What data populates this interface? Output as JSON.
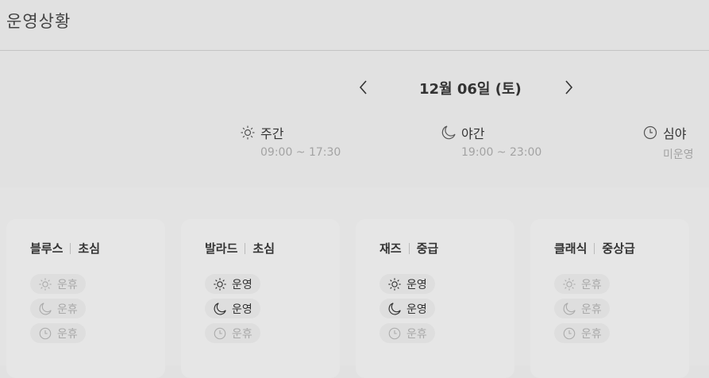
{
  "header": {
    "title": "운영상황"
  },
  "date_nav": {
    "date": "12월 06일 (토)",
    "prev_icon": "chevron-left-icon",
    "next_icon": "chevron-right-icon"
  },
  "shifts": [
    {
      "icon": "sun-icon",
      "name": "주간",
      "time": "09:00 ~ 17:30"
    },
    {
      "icon": "moon-icon",
      "name": "야간",
      "time": "19:00 ~ 23:00"
    },
    {
      "icon": "clock-icon",
      "name": "심야",
      "time": "미운영"
    }
  ],
  "cards": [
    {
      "genre": "블루스",
      "level": "초심",
      "rows": [
        {
          "label": "운휴",
          "active": false
        },
        {
          "label": "운휴",
          "active": false
        },
        {
          "label": "운휴",
          "active": false
        }
      ]
    },
    {
      "genre": "발라드",
      "level": "초심",
      "rows": [
        {
          "label": "운영",
          "active": true
        },
        {
          "label": "운영",
          "active": true
        },
        {
          "label": "운휴",
          "active": false
        }
      ]
    },
    {
      "genre": "재즈",
      "level": "중급",
      "rows": [
        {
          "label": "운영",
          "active": true
        },
        {
          "label": "운영",
          "active": true
        },
        {
          "label": "운휴",
          "active": false
        }
      ]
    },
    {
      "genre": "클래식",
      "level": "중상급",
      "rows": [
        {
          "label": "운휴",
          "active": false
        },
        {
          "label": "운휴",
          "active": false
        },
        {
          "label": "운휴",
          "active": false
        }
      ]
    }
  ],
  "colors": {
    "active_text": "#333333",
    "inactive_text": "#a9a9a9",
    "time_text": "#a3a3a3"
  }
}
